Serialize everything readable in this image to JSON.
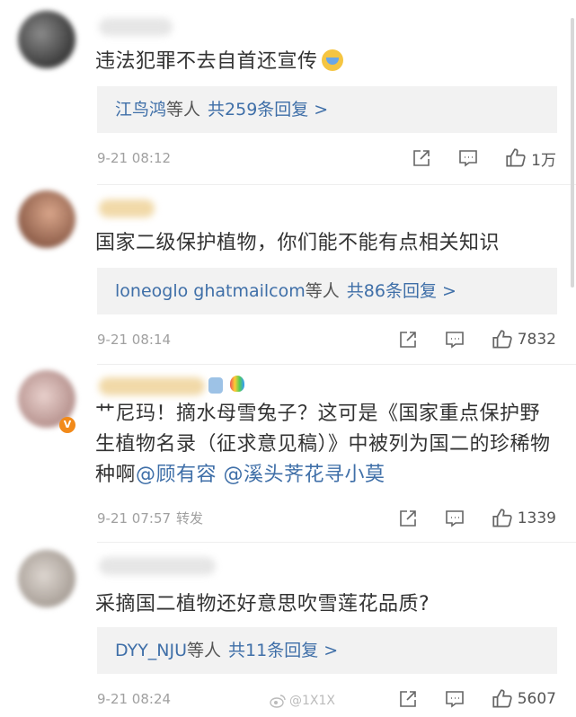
{
  "comments": [
    {
      "text": "违法犯罪不去自首还宣传",
      "reply_names": "江鸟鸿",
      "reply_others": "等人",
      "reply_count": "共259条回复",
      "reply_chevron": ">",
      "time": "9-21 08:12",
      "likes": "1万"
    },
    {
      "text": "国家二级保护植物，你们能不能有点相关知识",
      "reply_names": "loneoglo ghatmailcom",
      "reply_others": "等人",
      "reply_count": "共86条回复",
      "reply_chevron": ">",
      "time": "9-21 08:14",
      "likes": "7832"
    },
    {
      "text_main": "艹尼玛！摘水母雪兔子？这可是《国家重点保护野生植物名录（征求意见稿）》中被列为国二的珍稀物种啊",
      "mention1": "@顾有容",
      "mention2": "@溪头荠花寻小莫",
      "verified_mark": "V",
      "time": "9-21 07:57",
      "forward": "转发",
      "likes": "1339"
    },
    {
      "text": "采摘国二植物还好意思吹雪莲花品质?",
      "reply_names": "DYY_NJU",
      "reply_others": "等人",
      "reply_count": "共11条回复",
      "reply_chevron": ">",
      "time": "9-21 08:24",
      "likes": "5607"
    }
  ],
  "watermark": "@1X1X",
  "icons": {
    "share": "share-icon",
    "comment": "comment-icon",
    "like": "like-icon",
    "emoji": "crying-emoji-icon",
    "weibo": "weibo-logo-icon"
  },
  "colors": {
    "link": "#3f6fa8",
    "meta": "#a0a0a0",
    "reply_bg": "#f2f2f2"
  }
}
